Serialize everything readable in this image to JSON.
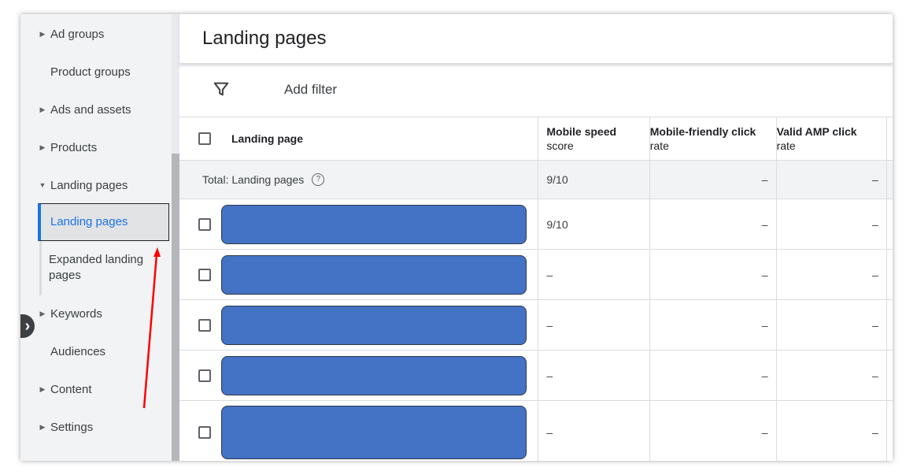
{
  "sidebar": {
    "items": [
      {
        "label": "Ad groups",
        "caret": "▶"
      },
      {
        "label": "Product groups",
        "caret": ""
      },
      {
        "label": "Ads and assets",
        "caret": "▶"
      },
      {
        "label": "Products",
        "caret": "▶"
      },
      {
        "label": "Landing pages",
        "caret": "▼"
      },
      {
        "label": "Keywords",
        "caret": "▶"
      },
      {
        "label": "Audiences",
        "caret": ""
      },
      {
        "label": "Content",
        "caret": "▶"
      },
      {
        "label": "Settings",
        "caret": "▶"
      }
    ],
    "sub_items": [
      {
        "label": "Landing pages"
      },
      {
        "label": "Expanded landing pages"
      }
    ],
    "collapse_glyph": "›"
  },
  "main": {
    "title": "Landing pages",
    "add_filter_label": "Add filter",
    "columns": {
      "landing_page": "Landing page",
      "mobile_speed_line1": "Mobile speed",
      "mobile_speed_line2": "score",
      "mobile_friendly_line1": "Mobile-friendly click",
      "mobile_friendly_line2": "rate",
      "valid_amp_line1": "Valid AMP click",
      "valid_amp_line2": "rate"
    },
    "total_row": {
      "label": "Total: Landing pages",
      "help_glyph": "?",
      "mobile_speed": "9/10",
      "mobile_friendly": "–",
      "valid_amp": "–"
    },
    "rows": [
      {
        "mobile_speed": "9/10",
        "mobile_friendly": "–",
        "valid_amp": "–"
      },
      {
        "mobile_speed": "–",
        "mobile_friendly": "–",
        "valid_amp": "–"
      },
      {
        "mobile_speed": "–",
        "mobile_friendly": "–",
        "valid_amp": "–"
      },
      {
        "mobile_speed": "–",
        "mobile_friendly": "–",
        "valid_amp": "–"
      },
      {
        "mobile_speed": "–",
        "mobile_friendly": "–",
        "valid_amp": "–"
      }
    ]
  },
  "colors": {
    "accent": "#1a73e8",
    "redaction": "#4472c4",
    "annotation_arrow": "#ff0000"
  }
}
